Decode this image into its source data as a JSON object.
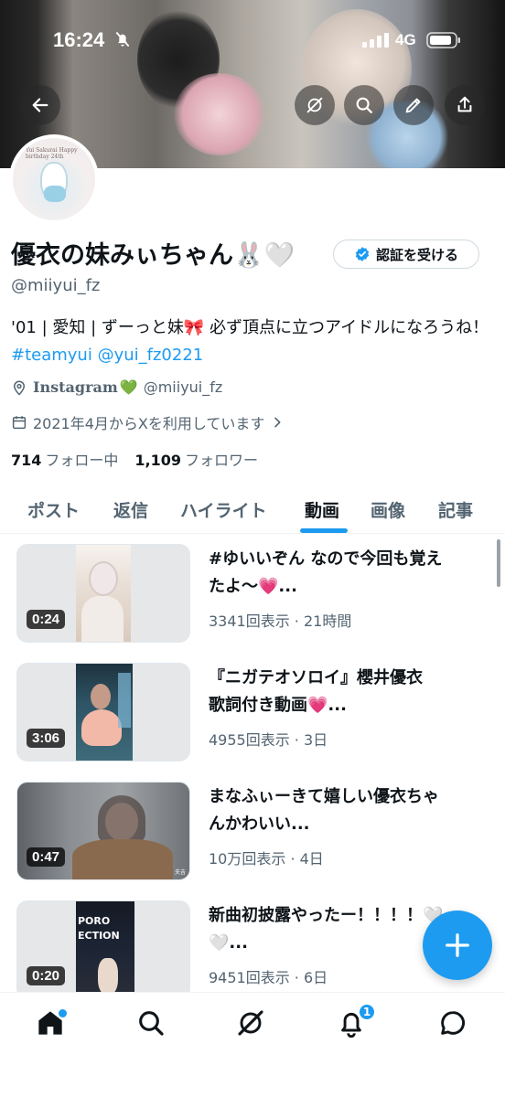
{
  "status_bar": {
    "time": "16:24",
    "network": "4G",
    "icons": [
      "mute-bell-icon",
      "signal-icon",
      "battery-icon"
    ]
  },
  "header": {
    "buttons": [
      "back-arrow-icon",
      "grok-icon",
      "search-icon",
      "edit-pen-icon",
      "share-icon"
    ]
  },
  "profile": {
    "avatar_caption": "Yui Sakurai  Happy birthday 24th",
    "display_name": "優衣の妹みぃちゃん🐰🤍",
    "verify_button": "認証を受ける",
    "handle": "@miiyui_fz",
    "bio_text": "'01 | 愛知 | ずーっと妹🎀 必ず頂点に立つアイドルになろうね！",
    "bio_links": [
      "#teamyui",
      "@yui_fz0221"
    ],
    "location_label": "Instagram",
    "location_heart": "💚",
    "location_handle": "@miiyui_fz",
    "joined": "2021年4月からXを利用しています",
    "following_count": "714",
    "following_label": "フォロー中",
    "followers_count": "1,109",
    "followers_label": "フォロワー"
  },
  "tabs": {
    "items": [
      "ポスト",
      "返信",
      "ハイライト",
      "動画",
      "画像",
      "記事"
    ],
    "active": "動画"
  },
  "videos": [
    {
      "title_line1": "#ゆいいぞん なので今回も覚え",
      "title_line2": "たよ〜💗...",
      "meta": "3341回表示 · 21時間",
      "duration": "0:24"
    },
    {
      "title_line1": "『ニガテオソロイ』櫻井優衣",
      "title_line2": "歌詞付き動画💗...",
      "meta": "4955回表示 · 3日",
      "duration": "3:06"
    },
    {
      "title_line1": "まなふぃーきて嬉しい優衣ちゃ",
      "title_line2": "んかわいい...",
      "meta": "10万回表示 · 4日",
      "duration": "0:47"
    },
    {
      "title_line1": "新曲初披露やったー！！！！🤍",
      "title_line2": "🤍...",
      "meta": "9451回表示 · 6日",
      "duration": "0:20"
    }
  ],
  "thumb_text": {
    "video4_overlay": "PORO ECTION",
    "video3_watermark": "夫吉"
  },
  "fab": {
    "icon": "plus-icon"
  },
  "bottom_nav": {
    "items": [
      "home-icon",
      "search-icon",
      "grok-icon",
      "bell-icon",
      "messages-icon"
    ],
    "notification_count": "1"
  },
  "colors": {
    "accent": "#1d9bf0",
    "text": "#0f1419",
    "secondary_text": "#536471"
  }
}
